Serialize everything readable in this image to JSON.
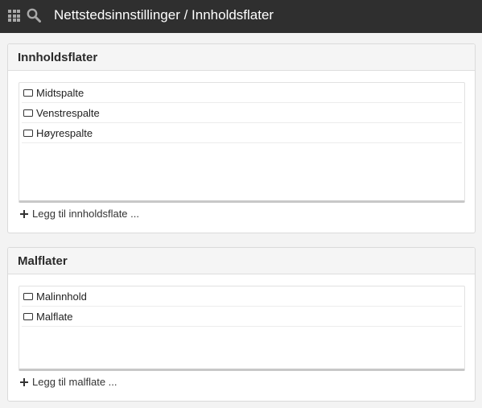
{
  "topbar": {
    "title": "Nettstedsinnstillinger / Innholdsflater",
    "apps_icon": "grid-icon",
    "search_icon": "search-icon"
  },
  "panels": [
    {
      "title": "Innholdsflater",
      "items": [
        "Midtspalte",
        "Venstrespalte",
        "Høyrespalte"
      ],
      "add_label": "Legg til innholdsflate ..."
    },
    {
      "title": "Malflater",
      "items": [
        "Malinnhold",
        "Malflate"
      ],
      "add_label": "Legg til malflate ..."
    }
  ],
  "colors": {
    "topbar_bg": "#2f2f2f",
    "page_bg": "#f3f3f3",
    "panel_header_bg": "#f5f5f5"
  }
}
